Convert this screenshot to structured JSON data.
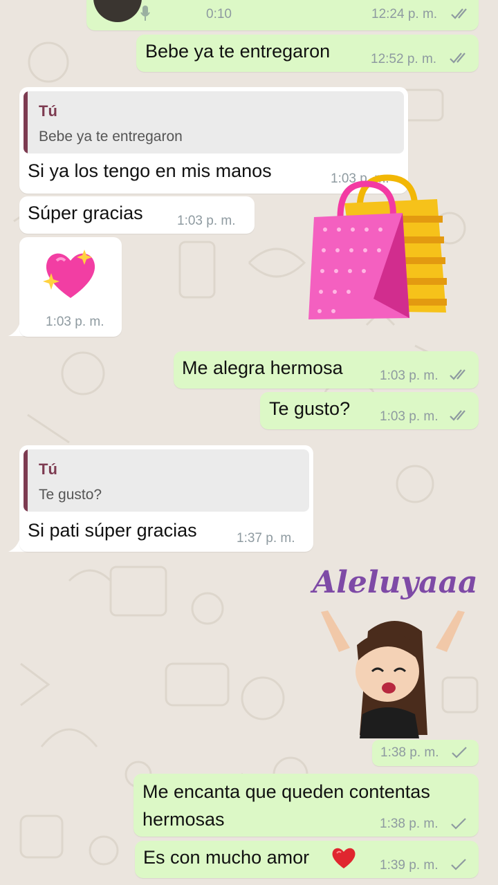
{
  "conversation": {
    "voice_note": {
      "duration": "0:10",
      "time": "12:24 p. m."
    },
    "messages": [
      {
        "text": "Bebe ya te entregaron",
        "time": "12:52 p. m."
      },
      {
        "quote_author": "Tú",
        "quote_text": "Bebe ya te entregaron",
        "text": "Si ya los tengo en mis manos",
        "time": "1:03 p. m."
      },
      {
        "text": "Súper gracias",
        "time": "1:03 p. m."
      },
      {
        "emoji_name": "sparkling-heart",
        "time": "1:03 p. m."
      },
      {
        "sticker_name": "shopping-bags-sticker"
      },
      {
        "text": "Me alegra hermosa",
        "time": "1:03 p. m."
      },
      {
        "text": "Te gusto?",
        "time": "1:03 p. m."
      },
      {
        "quote_author": "Tú",
        "quote_text": "Te gusto?",
        "text": "Si pati súper gracias",
        "time": "1:37 p. m."
      },
      {
        "sticker_text": "Aleluyaaa",
        "time": "1:38 p. m."
      },
      {
        "text": "Me encanta que queden contentas hermosas",
        "time": "1:38 p. m."
      },
      {
        "text": "Es con mucho amor",
        "emoji_name": "red-heart",
        "time": "1:39 p. m."
      }
    ]
  },
  "colors": {
    "outgoing_bubble": "#dcf8c6",
    "incoming_bubble": "#ffffff",
    "quote_accent": "#7d3b51",
    "read_ticks": "#8e9aa0",
    "background": "#ebe5de"
  }
}
